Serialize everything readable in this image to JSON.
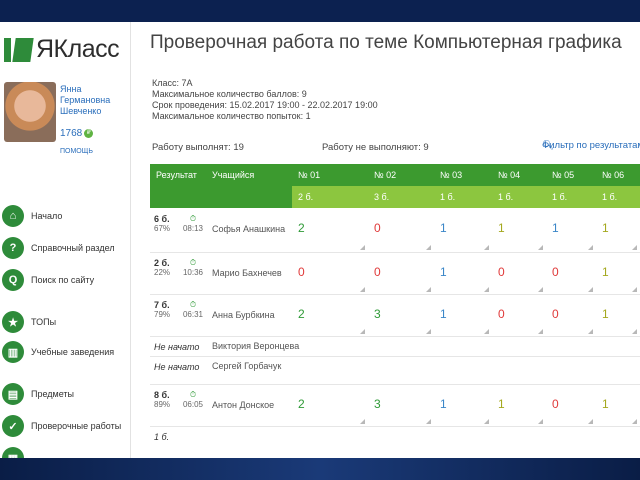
{
  "app": {
    "logo": "ЯКласс"
  },
  "user": {
    "name": "Янна Германовна Шевченко",
    "points": "1768",
    "help": "ПОМОЩЬ"
  },
  "sidebar": {
    "items": [
      {
        "label": "Начало",
        "icon": "home-icon",
        "color": "#2e8b3a",
        "glyph": "⌂"
      },
      {
        "label": "Справочный раздел",
        "icon": "help-icon",
        "color": "#2e8b3a",
        "glyph": "?"
      },
      {
        "label": "Поиск по сайту",
        "icon": "search-icon",
        "color": "#2e8b3a",
        "glyph": "Q"
      },
      {
        "label": "ТОПы",
        "icon": "star-icon",
        "color": "#2e8b3a",
        "glyph": "★"
      },
      {
        "label": "Учебные заведения",
        "icon": "building-icon",
        "color": "#2e8b3a",
        "glyph": "▥"
      },
      {
        "label": "Предметы",
        "icon": "book-icon",
        "color": "#2e8b3a",
        "glyph": "▤"
      },
      {
        "label": "Проверочные работы",
        "icon": "check-icon",
        "color": "#2e8b3a",
        "glyph": "✓"
      },
      {
        "label": "",
        "icon": "grid-icon",
        "color": "#2e8b3a",
        "glyph": "▦"
      }
    ]
  },
  "main": {
    "title": "Проверочная работа по теме Компьютерная графика",
    "info": [
      "Класс: 7А",
      "Максимальное количество баллов: 9",
      "Срок проведения: 15.02.2017 19:00 - 22.02.2017 19:00",
      "Максимальное количество попыток: 1"
    ],
    "done_count": "Работу выполнят: 19",
    "not_done_count": "Работу не выполняют: 9",
    "filter_link": "Фильтр по результатам"
  },
  "table": {
    "headers": {
      "result": "Результат",
      "student": "Учащийся",
      "tasks": [
        "№ 01",
        "№ 02",
        "№ 03",
        "№ 04",
        "№ 05",
        "№ 06"
      ],
      "max_points": [
        "2 б.",
        "3 б.",
        "1 б.",
        "1 б.",
        "1 б.",
        "1 б."
      ]
    },
    "colors": {
      "header_dark": "#3c9a2f",
      "header_light": "#8cc63f"
    },
    "rows": [
      {
        "score": "6 б.",
        "percent": "67%",
        "time": "08:13",
        "student": "Софья Анашкина",
        "marks": [
          "2",
          "0",
          "1",
          "1",
          "1",
          "1"
        ]
      },
      {
        "score": "2 б.",
        "percent": "22%",
        "time": "10:36",
        "student": "Марио Бахнечев",
        "marks": [
          "0",
          "0",
          "1",
          "0",
          "0",
          "1"
        ]
      },
      {
        "score": "7 б.",
        "percent": "79%",
        "time": "06:31",
        "student": "Анна Бурбкина",
        "marks": [
          "2",
          "3",
          "1",
          "0",
          "0",
          "1"
        ]
      },
      {
        "score": "Не начато",
        "percent": "",
        "time": "",
        "student": "Виктория Веронцева",
        "marks": [
          "",
          "",
          "",
          "",
          "",
          ""
        ]
      },
      {
        "score": "Не начато",
        "percent": "",
        "time": "",
        "student": "Сергей Горбачук",
        "marks": [
          "",
          "",
          "",
          "",
          "",
          ""
        ]
      },
      {
        "score": "8 б.",
        "percent": "89%",
        "time": "06:05",
        "student": "Антон Донское",
        "marks": [
          "2",
          "3",
          "1",
          "1",
          "0",
          "1"
        ]
      },
      {
        "score": "1 б.",
        "percent": "",
        "time": "",
        "student": "",
        "marks": [
          "",
          "",
          "",
          "",
          "",
          ""
        ]
      }
    ]
  }
}
